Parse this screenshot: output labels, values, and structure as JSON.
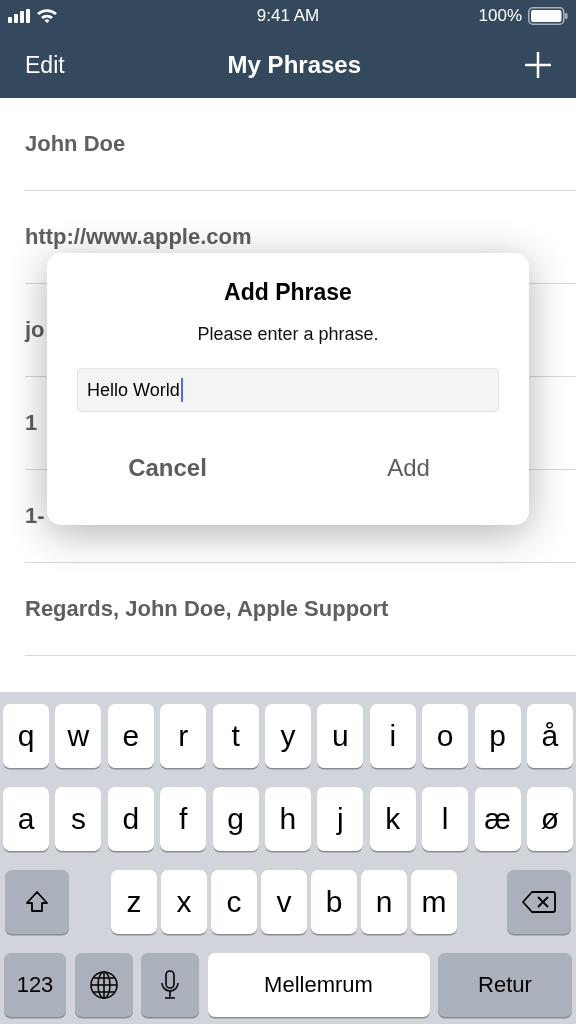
{
  "status_bar": {
    "time": "9:41 AM",
    "battery": "100%"
  },
  "nav": {
    "left": "Edit",
    "title": "My Phrases"
  },
  "phrases": [
    "John Doe",
    "http://www.apple.com",
    "jo",
    "1",
    "1-",
    "Regards, John Doe, Apple Support"
  ],
  "dialog": {
    "title": "Add Phrase",
    "message": "Please enter a phrase.",
    "field": {
      "value": "Hello World",
      "focused": true
    },
    "buttons": [
      {
        "label": "Cancel",
        "bold": true
      },
      {
        "label": "Add",
        "bold": false
      }
    ]
  },
  "keyboard": {
    "top_row": [
      {
        "kind": "letter",
        "label": "q"
      },
      {
        "kind": "letter",
        "label": "w"
      },
      {
        "kind": "letter",
        "label": "e"
      },
      {
        "kind": "letter",
        "label": "r"
      },
      {
        "kind": "letter",
        "label": "t"
      },
      {
        "kind": "letter",
        "label": "y"
      },
      {
        "kind": "letter",
        "label": "u"
      },
      {
        "kind": "letter",
        "label": "i"
      },
      {
        "kind": "letter",
        "label": "o"
      },
      {
        "kind": "letter",
        "label": "p"
      },
      {
        "kind": "letter",
        "label": "å"
      }
    ],
    "middle_row": [
      {
        "kind": "letter",
        "label": "a"
      },
      {
        "kind": "letter",
        "label": "s"
      },
      {
        "kind": "letter",
        "label": "d"
      },
      {
        "kind": "letter",
        "label": "f"
      },
      {
        "kind": "letter",
        "label": "g"
      },
      {
        "kind": "letter",
        "label": "h"
      },
      {
        "kind": "letter",
        "label": "j"
      },
      {
        "kind": "letter",
        "label": "k"
      },
      {
        "kind": "letter",
        "label": "l"
      },
      {
        "kind": "letter",
        "label": "æ"
      },
      {
        "kind": "letter",
        "label": "ø"
      }
    ],
    "shift_row": [
      {
        "kind": "shift"
      },
      {
        "kind": "letter",
        "label": "z"
      },
      {
        "kind": "letter",
        "label": "x"
      },
      {
        "kind": "letter",
        "label": "c"
      },
      {
        "kind": "letter",
        "label": "v"
      },
      {
        "kind": "letter",
        "label": "b"
      },
      {
        "kind": "letter",
        "label": "n"
      },
      {
        "kind": "letter",
        "label": "m"
      },
      {
        "kind": "backspace"
      }
    ],
    "bottom_row": [
      {
        "kind": "numbers",
        "label": "123"
      },
      {
        "kind": "globe"
      },
      {
        "kind": "mic"
      },
      {
        "kind": "space",
        "label": "Mellemrum"
      },
      {
        "kind": "return",
        "label": "Retur"
      }
    ]
  }
}
